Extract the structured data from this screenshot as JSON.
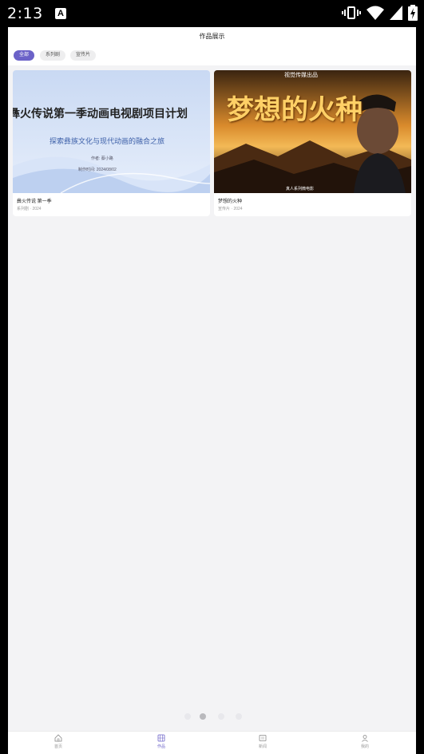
{
  "status_bar": {
    "time": "2:13",
    "notif_letter": "A"
  },
  "header": {
    "title": "作品展示"
  },
  "filter_tabs": [
    {
      "label": "全部",
      "active": true
    },
    {
      "label": "系列剧",
      "active": false
    },
    {
      "label": "宣传片",
      "active": false
    }
  ],
  "works": [
    {
      "title": "彝火传说 第一季",
      "meta": "系列剧 · 2024",
      "poster": {
        "headline": "彝火传说第一季动画电视剧项目计划",
        "subtitle": "探索彝族文化与现代动画的融合之旅",
        "author": "作者: 蔡小路",
        "date": "制作时间: 2024/08/02"
      }
    },
    {
      "title": "梦想的火种",
      "meta": "宣传片 · 2024",
      "poster": {
        "top": "视觉传媒出品",
        "headline": "梦想的火种",
        "bottom": "真人系列微电影"
      }
    }
  ],
  "pager": {
    "count": 4,
    "active": 1
  },
  "bottom_nav": [
    {
      "label": "首页",
      "icon": "home-icon",
      "active": false
    },
    {
      "label": "作品",
      "icon": "works-icon",
      "active": true
    },
    {
      "label": "新闻",
      "icon": "news-icon",
      "active": false
    },
    {
      "label": "我的",
      "icon": "profile-icon",
      "active": false
    }
  ],
  "colors": {
    "accent": "#6b62c8",
    "background": "#f3f3f5"
  }
}
